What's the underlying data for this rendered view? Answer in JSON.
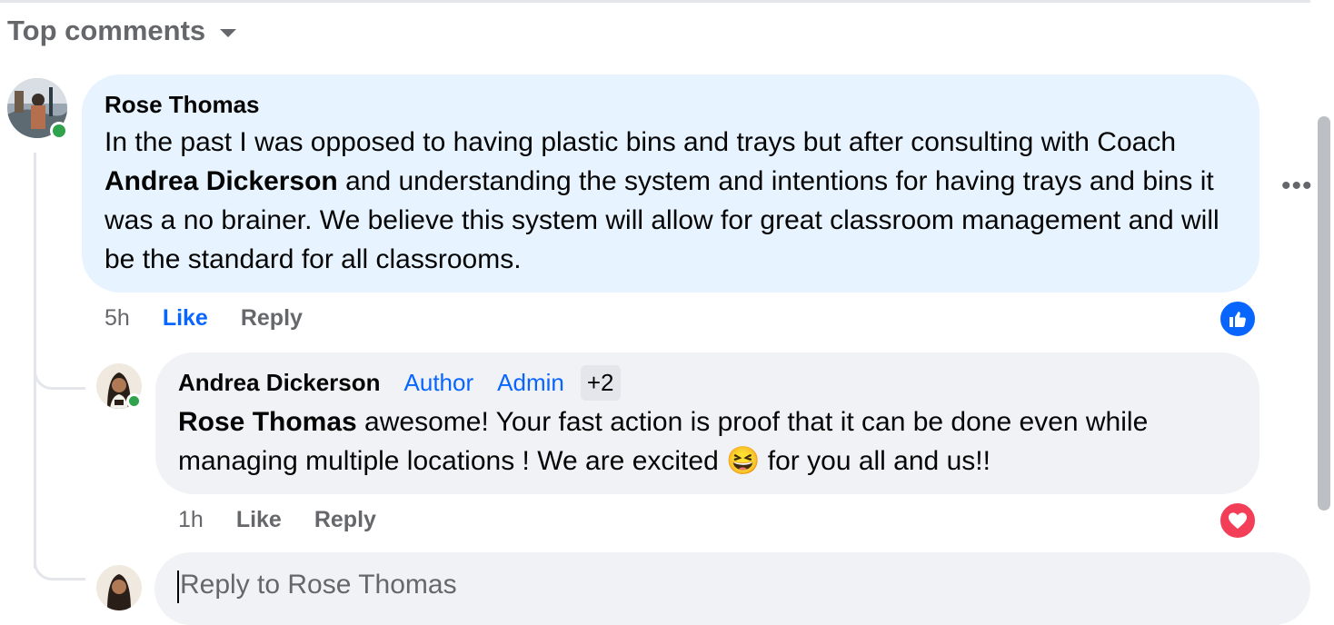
{
  "sort": {
    "label": "Top comments",
    "icon": "caret-down-icon"
  },
  "comment": {
    "author": "Rose Thomas",
    "text_1": "In the past I was opposed to having plastic bins and trays but after consulting with Coach ",
    "mention": "Andrea Dickerson",
    "text_2": " and understanding the system and intentions for having trays and bins it was a no brainer. We believe this system will allow for great classroom management and will be the standard for all classrooms.",
    "time": "5h",
    "like_label": "Like",
    "reply_label": "Reply",
    "reaction": "like-reaction-icon"
  },
  "reply": {
    "author": "Andrea Dickerson",
    "badges": [
      "Author",
      "Admin"
    ],
    "badges_more": "+2",
    "mention": "Rose Thomas",
    "text_1": " awesome! Your fast action is proof that it can be done even while managing multiple locations ! We are excited ",
    "emoji": "😆",
    "text_2": " for you all and us!!",
    "time": "1h",
    "like_label": "Like",
    "reply_label": "Reply",
    "reaction": "love-reaction-icon"
  },
  "reply_input": {
    "placeholder": "Reply to Rose Thomas"
  },
  "colors": {
    "accent": "#0866ff",
    "online": "#31a24c",
    "love": "#f33e58",
    "bubble_blue": "#e7f3ff",
    "bubble_grey": "#f0f2f5"
  }
}
